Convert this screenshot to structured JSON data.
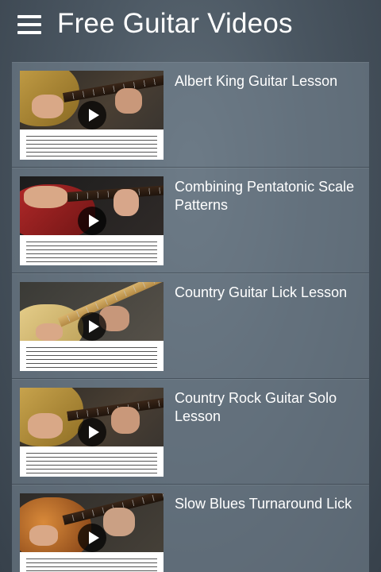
{
  "header": {
    "menu_icon": "hamburger-menu-icon",
    "title": "Free Guitar Videos"
  },
  "videos": [
    {
      "title": "Albert King Guitar Lesson",
      "play_icon": "play-icon"
    },
    {
      "title": "Combining Pentatonic Scale Patterns",
      "play_icon": "play-icon"
    },
    {
      "title": "Country Guitar Lick Lesson",
      "play_icon": "play-icon"
    },
    {
      "title": "Country Rock Guitar Solo Lesson",
      "play_icon": "play-icon"
    },
    {
      "title": "Slow Blues Turnaround Lick",
      "play_icon": "play-icon"
    }
  ],
  "colors": {
    "background": "#4a5661",
    "row_background": "#6f7d8a",
    "text": "#ffffff"
  }
}
